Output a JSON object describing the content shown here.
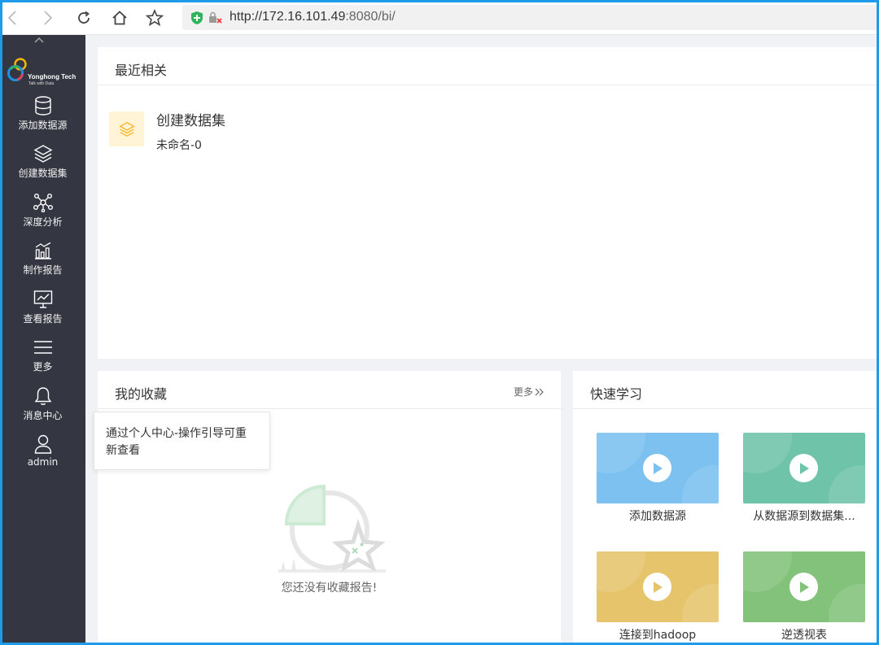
{
  "browser": {
    "url_host": "http://172.16.101.49",
    "url_rest": ":8080/bi/",
    "icons": [
      "back-icon",
      "forward-icon",
      "reload-icon",
      "home-icon",
      "star-icon",
      "shield-icon",
      "lock-icon"
    ]
  },
  "sidebar": {
    "logo": {
      "brand": "Yonghong Tech",
      "tagline": "Talk with Data"
    },
    "items": [
      {
        "label": "添加数据源",
        "icon": "database-icon"
      },
      {
        "label": "创建数据集",
        "icon": "layers-icon"
      },
      {
        "label": "深度分析",
        "icon": "network-icon"
      },
      {
        "label": "制作报告",
        "icon": "bar-chart-icon"
      },
      {
        "label": "查看报告",
        "icon": "monitor-chart-icon"
      },
      {
        "label": "更多",
        "icon": "menu-icon"
      },
      {
        "label": "消息中心",
        "icon": "bell-icon"
      },
      {
        "label": "admin",
        "icon": "user-icon"
      }
    ]
  },
  "recent": {
    "title": "最近相关",
    "item": {
      "title": "创建数据集",
      "subtitle": "未命名-0"
    }
  },
  "favorites": {
    "title": "我的收藏",
    "more_label": "更多",
    "empty_text": "您还没有收藏报告!"
  },
  "learn": {
    "title": "快速学习",
    "videos": [
      {
        "label": "添加数据源",
        "color": "#7cc1ef"
      },
      {
        "label": "从数据源到数据集...",
        "color": "#6fc3a9"
      },
      {
        "label": "连接到hadoop",
        "color": "#e6c46c"
      },
      {
        "label": "逆透视表",
        "color": "#82c27a"
      }
    ]
  },
  "tooltip": {
    "text": "通过个人中心-操作引导可重新查看"
  },
  "colors": {
    "sidebar_bg": "#343741",
    "main_bg": "#f0f2f5",
    "frame": "#1e9be8"
  }
}
